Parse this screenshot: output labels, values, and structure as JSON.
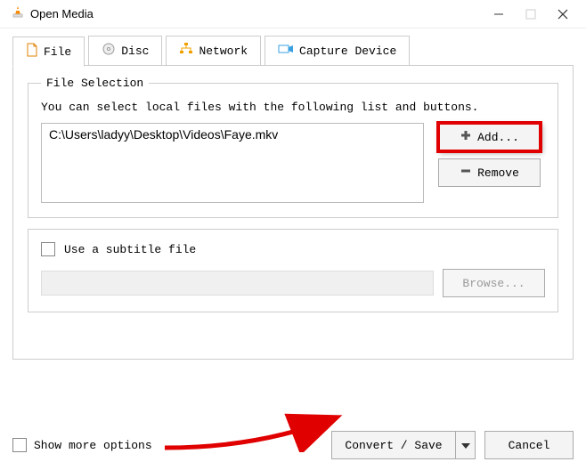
{
  "window": {
    "title": "Open Media"
  },
  "tabs": {
    "file": "File",
    "disc": "Disc",
    "network": "Network",
    "capture": "Capture Device"
  },
  "fileSelection": {
    "legend": "File Selection",
    "instruction": "You can select local files with the following list and buttons.",
    "items": [
      "C:\\Users\\ladyy\\Desktop\\Videos\\Faye.mkv"
    ],
    "addLabel": "Add...",
    "removeLabel": "Remove"
  },
  "subtitle": {
    "checkboxLabel": "Use a subtitle file",
    "browseLabel": "Browse..."
  },
  "footer": {
    "showMore": "Show more options",
    "convertSave": "Convert / Save",
    "cancel": "Cancel"
  }
}
